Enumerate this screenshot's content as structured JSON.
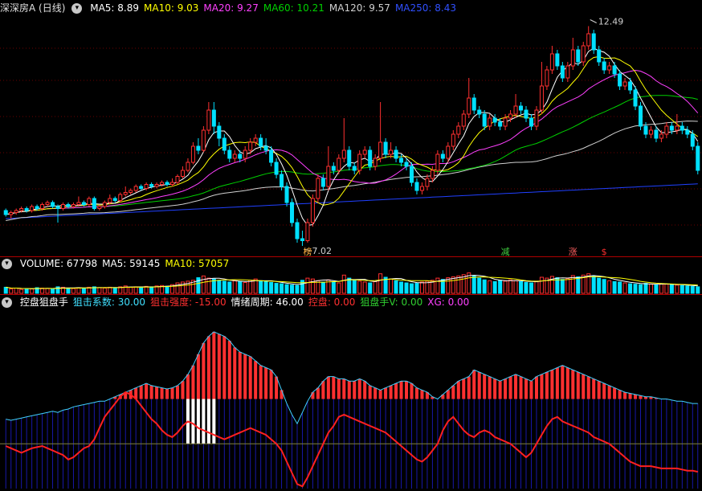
{
  "main": {
    "title": "深深房A (日线)",
    "ma_labels": [
      {
        "text": "MA5: 8.89",
        "color": "#ffffff"
      },
      {
        "text": "MA10: 9.03",
        "color": "#ffff00"
      },
      {
        "text": "MA20: 9.27",
        "color": "#ff40ff"
      },
      {
        "text": "MA60: 10.21",
        "color": "#00d000"
      },
      {
        "text": "MA120: 9.57",
        "color": "#d0d0d0"
      },
      {
        "text": "MA250: 8.43",
        "color": "#3050ff"
      }
    ],
    "high_label": "12.49",
    "low_label": "7.02",
    "markers": [
      {
        "text": "榜",
        "color": "#ffb040"
      },
      {
        "text": "减",
        "color": "#40d040"
      },
      {
        "text": "涨",
        "color": "#ff6060"
      },
      {
        "text": "$",
        "color": "#ff3030"
      }
    ]
  },
  "volume": {
    "labels": [
      {
        "text": "VOLUME: 67798",
        "color": "#ffffff"
      },
      {
        "text": "MA5: 59145",
        "color": "#ffffff"
      },
      {
        "text": "MA10: 57057",
        "color": "#ffff00"
      }
    ]
  },
  "indicator": {
    "labels": [
      {
        "text": "控盘狙盘手",
        "color": "#ffffff"
      },
      {
        "text": "狙击系数: 30.00",
        "color": "#40e0ff"
      },
      {
        "text": "狙击强度: -15.00",
        "color": "#ff3030"
      },
      {
        "text": "情绪周期: 46.00",
        "color": "#ffffff"
      },
      {
        "text": "控盘: 0.00",
        "color": "#ff3030"
      },
      {
        "text": "狙盘手V: 0.00",
        "color": "#30d030"
      },
      {
        "text": "XG: 0.00",
        "color": "#ff40ff"
      }
    ]
  },
  "colors": {
    "up": "#ff3030",
    "down": "#00e0ff",
    "ma5": "#ffffff",
    "ma10": "#ffff00",
    "ma20": "#ff40ff",
    "ma60": "#00d000",
    "ma120": "#d0d0d0",
    "ma250": "#2040ff"
  },
  "chart_data": {
    "type": "candlestick",
    "price_range": [
      6.9,
      12.7
    ],
    "candles": [
      [
        7.9,
        7.8,
        7.95,
        7.75
      ],
      [
        7.8,
        7.85,
        7.9,
        7.7
      ],
      [
        7.85,
        7.9,
        7.95,
        7.8
      ],
      [
        7.9,
        7.95,
        8.0,
        7.85
      ],
      [
        7.95,
        7.9,
        8.0,
        7.85
      ],
      [
        7.9,
        8.0,
        8.05,
        7.85
      ],
      [
        8.0,
        7.95,
        8.05,
        7.9
      ],
      [
        7.95,
        8.05,
        8.1,
        7.9
      ],
      [
        8.05,
        8.1,
        8.15,
        8.0
      ],
      [
        8.1,
        8.0,
        8.15,
        7.95
      ],
      [
        8.0,
        7.95,
        8.05,
        7.6
      ],
      [
        7.95,
        8.05,
        8.1,
        7.9
      ],
      [
        8.05,
        8.0,
        8.1,
        7.95
      ],
      [
        8.0,
        8.05,
        8.1,
        7.95
      ],
      [
        8.05,
        8.1,
        8.25,
        8.0
      ],
      [
        8.1,
        8.05,
        8.15,
        8.0
      ],
      [
        8.05,
        8.2,
        8.25,
        8.0
      ],
      [
        8.2,
        7.95,
        8.25,
        7.9
      ],
      [
        7.95,
        8.0,
        8.05,
        7.9
      ],
      [
        8.0,
        8.1,
        8.15,
        7.95
      ],
      [
        8.1,
        8.2,
        8.3,
        8.05
      ],
      [
        8.2,
        8.15,
        8.25,
        8.1
      ],
      [
        8.15,
        8.3,
        8.35,
        8.1
      ],
      [
        8.3,
        8.35,
        8.5,
        8.25
      ],
      [
        8.35,
        8.4,
        8.45,
        8.3
      ],
      [
        8.4,
        8.5,
        8.55,
        8.35
      ],
      [
        8.5,
        8.45,
        8.55,
        8.4
      ],
      [
        8.45,
        8.55,
        8.6,
        8.4
      ],
      [
        8.55,
        8.5,
        8.6,
        8.45
      ],
      [
        8.5,
        8.55,
        8.6,
        8.45
      ],
      [
        8.55,
        8.6,
        8.65,
        8.5
      ],
      [
        8.6,
        8.55,
        8.65,
        8.5
      ],
      [
        8.55,
        8.6,
        8.7,
        8.5
      ],
      [
        8.6,
        8.75,
        8.8,
        8.55
      ],
      [
        8.75,
        8.9,
        9.0,
        8.7
      ],
      [
        8.9,
        9.1,
        9.2,
        8.85
      ],
      [
        9.1,
        9.5,
        9.6,
        9.05
      ],
      [
        9.5,
        9.4,
        9.7,
        9.3
      ],
      [
        9.4,
        9.9,
        10.0,
        9.35
      ],
      [
        9.9,
        10.4,
        10.6,
        9.8
      ],
      [
        10.4,
        10.0,
        10.6,
        9.8
      ],
      [
        10.0,
        9.7,
        10.1,
        9.5
      ],
      [
        9.7,
        9.4,
        9.8,
        9.3
      ],
      [
        9.4,
        9.2,
        9.5,
        9.1
      ],
      [
        9.2,
        9.3,
        9.4,
        9.1
      ],
      [
        9.3,
        9.2,
        9.4,
        9.1
      ],
      [
        9.2,
        9.4,
        9.5,
        9.1
      ],
      [
        9.4,
        9.6,
        9.7,
        9.3
      ],
      [
        9.6,
        9.7,
        9.8,
        9.5
      ],
      [
        9.7,
        9.5,
        9.8,
        9.4
      ],
      [
        9.5,
        9.4,
        9.7,
        9.3
      ],
      [
        9.4,
        9.1,
        9.5,
        9.0
      ],
      [
        9.1,
        8.8,
        9.2,
        8.7
      ],
      [
        8.8,
        8.5,
        8.9,
        8.4
      ],
      [
        8.5,
        8.1,
        8.6,
        8.0
      ],
      [
        8.1,
        7.6,
        8.2,
        7.5
      ],
      [
        7.6,
        7.2,
        7.7,
        7.1
      ],
      [
        7.2,
        7.15,
        7.4,
        7.02
      ],
      [
        7.15,
        7.6,
        7.7,
        7.1
      ],
      [
        7.6,
        8.2,
        8.3,
        7.5
      ],
      [
        8.2,
        8.7,
        8.8,
        8.1
      ],
      [
        8.7,
        8.5,
        8.8,
        8.4
      ],
      [
        8.5,
        9.0,
        9.5,
        8.4
      ],
      [
        9.0,
        8.9,
        9.1,
        8.8
      ],
      [
        8.9,
        9.2,
        9.3,
        8.8
      ],
      [
        9.2,
        9.4,
        10.2,
        9.1
      ],
      [
        9.4,
        9.0,
        9.5,
        8.9
      ],
      [
        9.0,
        8.9,
        9.1,
        8.8
      ],
      [
        8.9,
        9.3,
        9.4,
        8.8
      ],
      [
        9.3,
        9.4,
        9.5,
        9.2
      ],
      [
        9.4,
        9.0,
        9.5,
        8.9
      ],
      [
        9.0,
        9.2,
        9.3,
        8.9
      ],
      [
        9.2,
        9.6,
        10.6,
        9.1
      ],
      [
        9.6,
        9.3,
        9.7,
        9.2
      ],
      [
        9.3,
        9.4,
        9.6,
        9.2
      ],
      [
        9.4,
        9.2,
        9.5,
        9.1
      ],
      [
        9.2,
        9.1,
        9.3,
        9.0
      ],
      [
        9.1,
        9.0,
        9.2,
        8.9
      ],
      [
        9.0,
        8.6,
        9.1,
        8.5
      ],
      [
        8.6,
        8.4,
        8.7,
        8.3
      ],
      [
        8.4,
        8.5,
        8.6,
        8.3
      ],
      [
        8.5,
        8.7,
        8.8,
        8.4
      ],
      [
        8.7,
        8.9,
        9.0,
        8.6
      ],
      [
        8.9,
        9.3,
        9.4,
        8.8
      ],
      [
        9.3,
        9.2,
        9.4,
        9.1
      ],
      [
        9.2,
        9.5,
        9.6,
        9.1
      ],
      [
        9.5,
        9.8,
        9.9,
        9.4
      ],
      [
        9.8,
        10.0,
        10.1,
        9.7
      ],
      [
        10.0,
        10.3,
        10.4,
        9.9
      ],
      [
        10.3,
        10.7,
        11.2,
        10.2
      ],
      [
        10.7,
        10.4,
        10.8,
        10.3
      ],
      [
        10.4,
        10.3,
        10.5,
        10.2
      ],
      [
        10.3,
        10.0,
        10.4,
        9.9
      ],
      [
        10.0,
        10.2,
        10.3,
        9.9
      ],
      [
        10.2,
        10.1,
        10.3,
        10.0
      ],
      [
        10.1,
        10.0,
        10.2,
        9.9
      ],
      [
        10.0,
        10.2,
        10.3,
        9.9
      ],
      [
        10.2,
        10.3,
        10.4,
        10.1
      ],
      [
        10.3,
        10.5,
        10.8,
        10.2
      ],
      [
        10.5,
        10.4,
        10.6,
        10.3
      ],
      [
        10.4,
        10.2,
        10.5,
        10.1
      ],
      [
        10.2,
        10.0,
        10.3,
        9.9
      ],
      [
        10.0,
        10.4,
        10.5,
        9.9
      ],
      [
        10.4,
        11.0,
        11.6,
        10.3
      ],
      [
        11.0,
        11.4,
        11.5,
        10.9
      ],
      [
        11.4,
        11.8,
        12.0,
        11.3
      ],
      [
        11.8,
        11.5,
        11.9,
        11.4
      ],
      [
        11.5,
        11.2,
        11.6,
        11.1
      ],
      [
        11.2,
        11.5,
        11.6,
        11.1
      ],
      [
        11.5,
        11.9,
        12.2,
        11.4
      ],
      [
        11.9,
        11.6,
        12.0,
        11.5
      ],
      [
        11.6,
        12.0,
        12.1,
        11.5
      ],
      [
        12.0,
        12.3,
        12.49,
        11.9
      ],
      [
        12.3,
        11.9,
        12.4,
        11.8
      ],
      [
        11.9,
        11.6,
        12.0,
        11.5
      ],
      [
        11.6,
        11.4,
        11.7,
        11.3
      ],
      [
        11.4,
        11.5,
        11.6,
        11.3
      ],
      [
        11.5,
        11.3,
        11.6,
        11.2
      ],
      [
        11.3,
        11.0,
        11.4,
        10.9
      ],
      [
        11.0,
        11.1,
        11.2,
        10.9
      ],
      [
        11.1,
        10.9,
        11.2,
        10.8
      ],
      [
        10.9,
        10.5,
        11.0,
        10.4
      ],
      [
        10.5,
        10.0,
        10.6,
        9.9
      ],
      [
        10.0,
        9.8,
        10.1,
        9.7
      ],
      [
        9.8,
        9.9,
        10.0,
        9.7
      ],
      [
        9.9,
        9.7,
        10.0,
        9.6
      ],
      [
        9.7,
        9.8,
        9.9,
        9.6
      ],
      [
        9.8,
        10.0,
        10.1,
        9.7
      ],
      [
        10.0,
        9.9,
        10.1,
        9.8
      ],
      [
        9.9,
        10.0,
        10.3,
        9.8
      ],
      [
        10.0,
        9.9,
        10.1,
        9.8
      ],
      [
        9.9,
        9.8,
        10.0,
        9.7
      ],
      [
        9.8,
        9.5,
        9.9,
        9.4
      ],
      [
        9.5,
        8.9,
        9.6,
        8.8
      ]
    ],
    "volumes": [
      28,
      20,
      24,
      18,
      22,
      20,
      26,
      24,
      22,
      20,
      30,
      28,
      24,
      22,
      26,
      24,
      28,
      30,
      26,
      24,
      28,
      26,
      30,
      34,
      28,
      30,
      26,
      32,
      30,
      34,
      36,
      32,
      40,
      48,
      52,
      56,
      60,
      72,
      80,
      70,
      66,
      60,
      56,
      52,
      58,
      54,
      50,
      60,
      66,
      58,
      54,
      50,
      46,
      44,
      40,
      38,
      36,
      60,
      70,
      66,
      58,
      52,
      62,
      54,
      48,
      84,
      70,
      60,
      56,
      52,
      48,
      54,
      90,
      74,
      66,
      58,
      52,
      48,
      44,
      46,
      52,
      56,
      60,
      70,
      64,
      72,
      76,
      80,
      86,
      94,
      80,
      70,
      62,
      58,
      54,
      60,
      56,
      62,
      58,
      54,
      50,
      48,
      56,
      74,
      70,
      78,
      72,
      64,
      68,
      82,
      76,
      84,
      90,
      78,
      70,
      64,
      58,
      54,
      52,
      48,
      44,
      42,
      40,
      46,
      42,
      40,
      44,
      42,
      40,
      38,
      36,
      34,
      32,
      30
    ],
    "indicator_range": [
      -40,
      120
    ],
    "indicator": {
      "sniper_strength": [
        22,
        21,
        22,
        23,
        24,
        25,
        26,
        27,
        28,
        29,
        28,
        30,
        31,
        33,
        34,
        35,
        36,
        37,
        38,
        38,
        40,
        42,
        44,
        46,
        48,
        50,
        52,
        54,
        52,
        51,
        50,
        49,
        50,
        52,
        56,
        62,
        70,
        80,
        90,
        96,
        100,
        98,
        96,
        92,
        86,
        82,
        80,
        78,
        74,
        70,
        68,
        66,
        60,
        48,
        36,
        26,
        18,
        28,
        38,
        46,
        50,
        56,
        60,
        60,
        58,
        58,
        56,
        56,
        58,
        56,
        52,
        50,
        48,
        50,
        52,
        54,
        56,
        56,
        54,
        50,
        48,
        46,
        42,
        40,
        44,
        48,
        52,
        56,
        58,
        60,
        66,
        64,
        62,
        60,
        58,
        56,
        58,
        60,
        62,
        60,
        58,
        56,
        60,
        62,
        64,
        66,
        68,
        70,
        68,
        66,
        64,
        62,
        60,
        58,
        56,
        54,
        52,
        50,
        48,
        46,
        45,
        44,
        43,
        42,
        42,
        41,
        40,
        40,
        39,
        38,
        38,
        37,
        36,
        36
      ],
      "emotion_cycle": [
        -2,
        -4,
        -6,
        -8,
        -6,
        -4,
        -3,
        -2,
        -4,
        -6,
        -8,
        -10,
        -14,
        -12,
        -8,
        -4,
        -2,
        4,
        14,
        24,
        30,
        36,
        42,
        46,
        44,
        40,
        34,
        28,
        22,
        18,
        12,
        8,
        6,
        10,
        16,
        20,
        18,
        14,
        12,
        10,
        8,
        6,
        4,
        6,
        8,
        10,
        12,
        14,
        12,
        10,
        8,
        4,
        0,
        -6,
        -16,
        -26,
        -36,
        -38,
        -30,
        -20,
        -10,
        0,
        10,
        16,
        24,
        26,
        24,
        22,
        20,
        18,
        16,
        14,
        12,
        10,
        6,
        2,
        -2,
        -6,
        -10,
        -14,
        -16,
        -12,
        -6,
        0,
        12,
        20,
        24,
        18,
        12,
        8,
        6,
        10,
        12,
        10,
        6,
        4,
        2,
        0,
        -4,
        -8,
        -12,
        -8,
        0,
        8,
        16,
        22,
        24,
        20,
        18,
        16,
        14,
        12,
        10,
        6,
        4,
        2,
        0,
        -4,
        -8,
        -12,
        -16,
        -18,
        -20,
        -20,
        -20,
        -21,
        -22,
        -22,
        -22,
        -22,
        -23,
        -24,
        -24,
        -25
      ],
      "white_bar_indices": [
        35,
        36,
        37,
        38,
        39,
        40
      ]
    }
  }
}
